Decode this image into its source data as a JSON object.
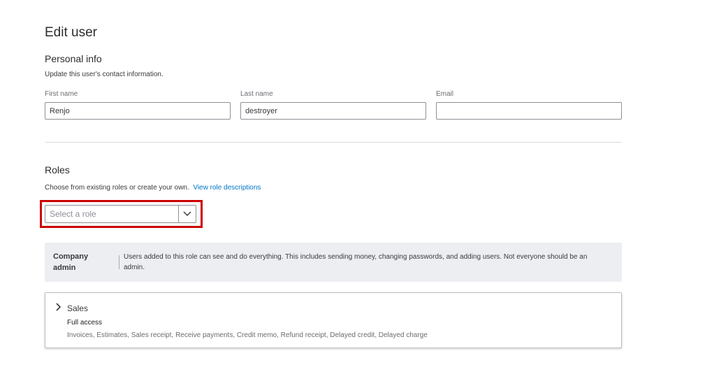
{
  "title": "Edit user",
  "personal": {
    "heading": "Personal info",
    "subtitle": "Update this user's contact information.",
    "first_name_label": "First name",
    "first_name_value": "Renjo",
    "last_name_label": "Last name",
    "last_name_value": "destroyer",
    "email_label": "Email",
    "email_value": ""
  },
  "roles": {
    "heading": "Roles",
    "description": "Choose from existing roles or create your own.",
    "link": "View role descriptions",
    "select_placeholder": "Select a role",
    "admin_title_1": "Company",
    "admin_title_2": "admin",
    "admin_desc": "Users added to this role can see and do everything. This includes sending money, changing passwords, and adding users. Not everyone should be an admin.",
    "sales": {
      "title": "Sales",
      "access": "Full access",
      "items": "Invoices, Estimates, Sales receipt, Receive payments, Credit memo, Refund receipt, Delayed credit, Delayed charge"
    }
  }
}
